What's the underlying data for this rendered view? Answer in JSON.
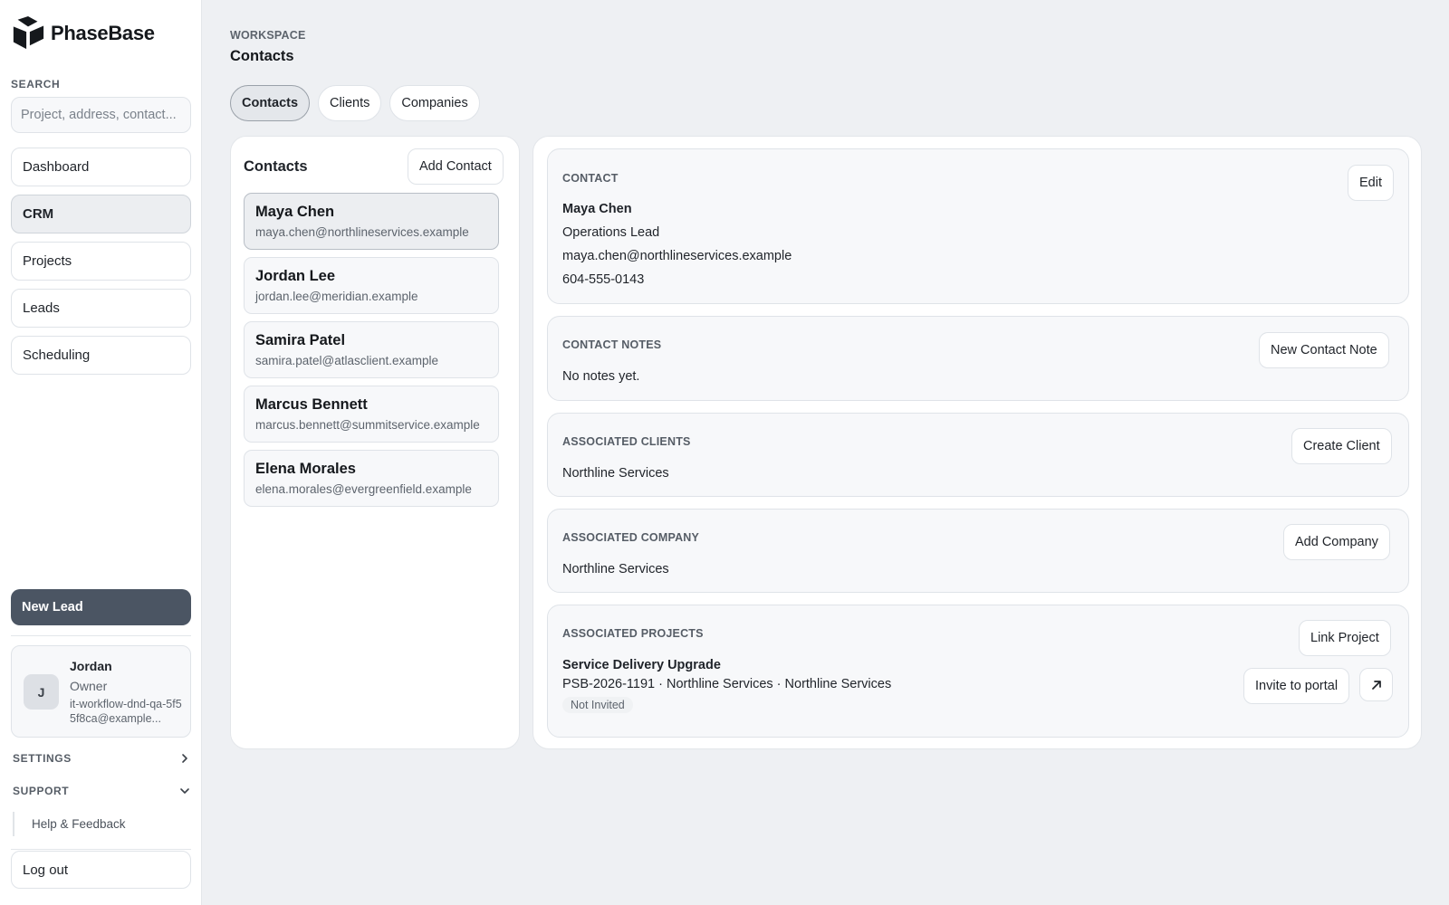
{
  "app": {
    "name": "PhaseBase"
  },
  "sidebar": {
    "search_label": "SEARCH",
    "search_placeholder": "Project, address, contact...",
    "nav": [
      {
        "label": "Dashboard"
      },
      {
        "label": "CRM",
        "active": true
      },
      {
        "label": "Projects"
      },
      {
        "label": "Leads"
      },
      {
        "label": "Scheduling"
      }
    ],
    "new_lead": "New Lead",
    "user": {
      "initial": "J",
      "name": "Jordan",
      "role": "Owner",
      "email": "it-workflow-dnd-qa-5f55f8ca@example..."
    },
    "settings": "SETTINGS",
    "support": "SUPPORT",
    "help": "Help & Feedback",
    "logout": "Log out"
  },
  "header": {
    "eyebrow": "WORKSPACE",
    "title": "Contacts"
  },
  "tabs": [
    {
      "label": "Contacts",
      "active": true
    },
    {
      "label": "Clients"
    },
    {
      "label": "Companies"
    }
  ],
  "contacts_panel": {
    "title": "Contacts",
    "add_button": "Add Contact",
    "items": [
      {
        "name": "Maya Chen",
        "email": "maya.chen@northlineservices.example",
        "selected": true
      },
      {
        "name": "Jordan Lee",
        "email": "jordan.lee@meridian.example"
      },
      {
        "name": "Samira Patel",
        "email": "samira.patel@atlasclient.example"
      },
      {
        "name": "Marcus Bennett",
        "email": "marcus.bennett@summitservice.example"
      },
      {
        "name": "Elena Morales",
        "email": "elena.morales@evergreenfield.example"
      }
    ]
  },
  "detail": {
    "contact": {
      "label": "CONTACT",
      "edit": "Edit",
      "name": "Maya Chen",
      "title": "Operations Lead",
      "email": "maya.chen@northlineservices.example",
      "phone": "604-555-0143"
    },
    "notes": {
      "label": "CONTACT NOTES",
      "button": "New Contact Note",
      "empty": "No notes yet."
    },
    "clients": {
      "label": "ASSOCIATED CLIENTS",
      "button": "Create Client",
      "value": "Northline Services"
    },
    "company": {
      "label": "ASSOCIATED COMPANY",
      "button": "Add Company",
      "value": "Northline Services"
    },
    "projects": {
      "label": "ASSOCIATED PROJECTS",
      "button": "Link Project",
      "project_name": "Service Delivery Upgrade",
      "project_meta": "PSB-2026-1191 · Northline Services · Northline Services",
      "status": "Not Invited",
      "invite": "Invite to portal",
      "open_icon": "arrow-up-right-icon"
    }
  },
  "colors": {
    "primary_button": "#4b5563",
    "background": "#eef0f3"
  }
}
